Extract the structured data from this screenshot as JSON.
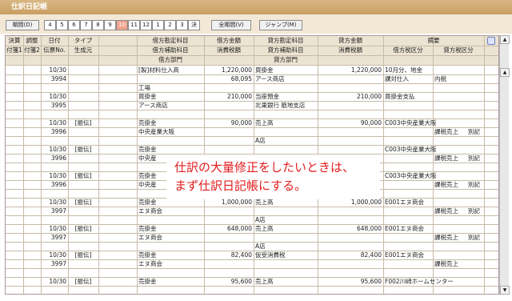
{
  "title": "仕訳日記帳",
  "toolbar": {
    "period_label": "期間(D)",
    "months": [
      "4",
      "5",
      "6",
      "7",
      "8",
      "9",
      "10",
      "11",
      "12",
      "1",
      "2",
      "3",
      "決"
    ],
    "selected_month": "10",
    "all_period_label": "全期間(V)",
    "jump_label": "ジャンプ(M)"
  },
  "headers": {
    "row1": [
      "決算",
      "調整",
      "日付",
      "タイプ",
      "借方勘定科目",
      "借方金額",
      "貸方勘定科目",
      "貸方金額",
      "摘要"
    ],
    "row2": [
      "付箋1",
      "付箋2",
      "伝票No.",
      "生成元",
      "借方補助科目",
      "消費税額",
      "貸方補助科目",
      "消費税額",
      "借方税区分",
      "貸方税区分"
    ],
    "row3": [
      "借方部門",
      "貸方部門"
    ]
  },
  "entries": [
    {
      "date": "10/30",
      "no": "3994",
      "type": "",
      "debit": "[製]材料仕入高",
      "debit_amt": "1,220,000",
      "credit": "買掛金",
      "credit_amt": "1,220,000",
      "memo": "10月分、地金",
      "debit_sub": "",
      "debit_tax": "68,095",
      "credit_sub": "アース商店",
      "credit_tax": "",
      "debit_tax_cat": "課対仕入",
      "credit_tax_cat": "内税",
      "debit_dept": "工場",
      "credit_dept": ""
    },
    {
      "date": "10/30",
      "no": "3995",
      "type": "",
      "debit": "買掛金",
      "debit_amt": "210,000",
      "credit": "当座預金",
      "credit_amt": "210,000",
      "memo": "買掛金支払",
      "debit_sub": "アース商店",
      "debit_tax": "",
      "credit_sub": "北東銀行 筋地支店",
      "credit_tax": "",
      "debit_tax_cat": "",
      "credit_tax_cat": "",
      "debit_dept": "",
      "credit_dept": ""
    },
    {
      "date": "10/30",
      "no": "3996",
      "type": "[振伝]",
      "debit": "売掛金",
      "debit_amt": "90,000",
      "credit": "売上高",
      "credit_amt": "90,000",
      "memo": "C003中央産業大阪",
      "debit_sub": "中央産業大阪",
      "debit_tax": "",
      "credit_sub": "",
      "credit_tax": "",
      "debit_tax_cat": "",
      "credit_tax_cat": "課税売上",
      "credit_tax_cat2": "別記",
      "debit_dept": "",
      "credit_dept": "A店"
    },
    {
      "date": "10/30",
      "no": "3996",
      "type": "[振伝]",
      "debit": "売掛金",
      "debit_amt": "",
      "credit": "",
      "credit_amt": "",
      "memo": "C003中央産業大阪",
      "debit_sub": "中央産",
      "debit_tax": "",
      "credit_sub": "",
      "credit_tax": "",
      "debit_tax_cat": "",
      "credit_tax_cat": "課税売上",
      "credit_tax_cat2": "別記",
      "debit_dept": "",
      "credit_dept": ""
    },
    {
      "date": "10/30",
      "no": "3996",
      "type": "[振伝]",
      "debit": "売掛金",
      "debit_amt": "",
      "credit": "",
      "credit_amt": "",
      "memo": "C003中央産業大阪",
      "debit_sub": "中央産",
      "debit_tax": "",
      "credit_sub": "",
      "credit_tax": "",
      "debit_tax_cat": "",
      "credit_tax_cat": "課税売上",
      "credit_tax_cat2": "別記",
      "debit_dept": "",
      "credit_dept": "A店"
    },
    {
      "date": "10/30",
      "no": "3997",
      "type": "[振伝]",
      "debit": "売掛金",
      "debit_amt": "1,000,000",
      "credit": "売上高",
      "credit_amt": "1,000,000",
      "memo": "E001エヌ商会",
      "debit_sub": "エヌ商会",
      "debit_tax": "",
      "credit_sub": "",
      "credit_tax": "",
      "debit_tax_cat": "",
      "credit_tax_cat": "課税売上",
      "credit_tax_cat2": "別記",
      "debit_dept": "",
      "credit_dept": "A店"
    },
    {
      "date": "10/30",
      "no": "3997",
      "type": "[振伝]",
      "debit": "売掛金",
      "debit_amt": "648,000",
      "credit": "売上高",
      "credit_amt": "648,000",
      "memo": "E001エヌ商会",
      "debit_sub": "エヌ商会",
      "debit_tax": "",
      "credit_sub": "",
      "credit_tax": "",
      "debit_tax_cat": "",
      "credit_tax_cat": "課税売上",
      "credit_tax_cat2": "別記",
      "debit_dept": "",
      "credit_dept": "A店"
    },
    {
      "date": "10/30",
      "no": "3997",
      "type": "[振伝]",
      "debit": "売掛金",
      "debit_amt": "82,400",
      "credit": "仮受消費税",
      "credit_amt": "82,400",
      "memo": "E001エヌ商会",
      "debit_sub": "エヌ商会",
      "debit_tax": "",
      "credit_sub": "",
      "credit_tax": "",
      "debit_tax_cat": "",
      "credit_tax_cat": "課税売上",
      "credit_tax_cat2": "",
      "debit_dept": "",
      "credit_dept": ""
    },
    {
      "date": "10/30",
      "no": "",
      "type": "[振伝]",
      "debit": "売掛金",
      "debit_amt": "95,600",
      "credit": "売上高",
      "credit_amt": "95,600",
      "memo": "F002川崎ホームセンター",
      "debit_sub": "",
      "debit_tax": "",
      "credit_sub": "",
      "credit_tax": "",
      "debit_tax_cat": "",
      "credit_tax_cat": "",
      "credit_tax_cat2": "",
      "debit_dept": "",
      "credit_dept": ""
    }
  ],
  "callout": {
    "line1": "仕訳の大量修正をしたいときは、",
    "line2": "まず仕訳日記帳にする。"
  }
}
